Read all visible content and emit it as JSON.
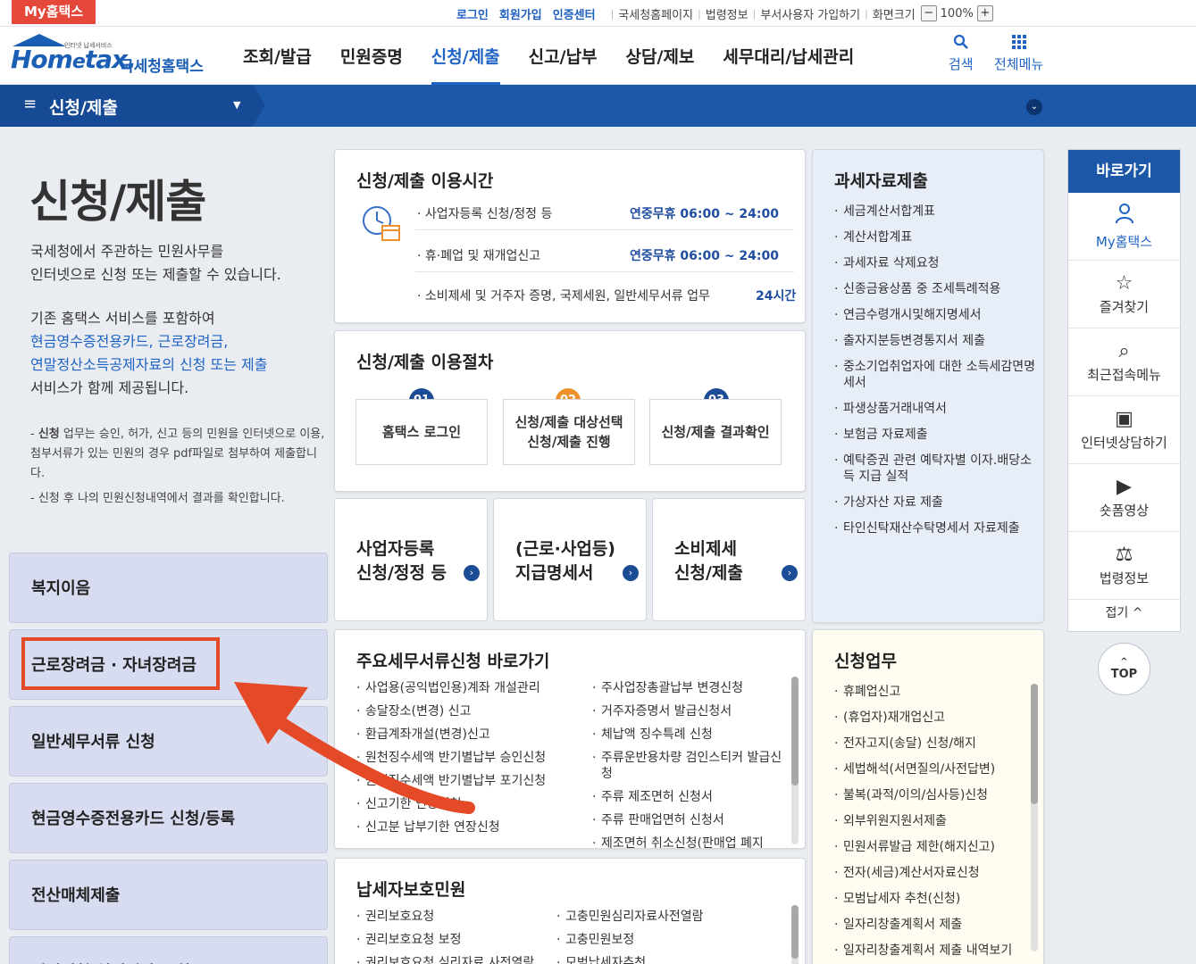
{
  "topbar": {
    "my_badge": "My홈택스",
    "login": "로그인",
    "join": "회원가입",
    "cert": "인증센터",
    "links": [
      "국세청홈페이지",
      "법령정보",
      "부서사용자 가입하기",
      "화면크기"
    ],
    "zoom_minus": "−",
    "zoom_value": "100%",
    "zoom_plus": "+"
  },
  "header": {
    "logo_small": "인터넷 납세서비스",
    "logo_home": "Hom",
    "logo_e": "e",
    "logo_tax": "tax.",
    "logo_kr": "국세청홈택스",
    "menu": [
      "조회/발급",
      "민원증명",
      "신청/제출",
      "신고/납부",
      "상담/제보",
      "세무대리/납세관리"
    ],
    "search": "검색",
    "all_menu": "전체메뉴"
  },
  "subnav": {
    "title": "신청/제출",
    "hamburger": "≡",
    "caret": "▼",
    "circle": "⌄"
  },
  "left": {
    "page_title": "신청/제출",
    "desc_line1": "국세청에서 주관하는 민원사무를",
    "desc_line2": "인터넷으로 신청 또는 제출할 수 있습니다.",
    "desc2_line1": "기존 홈택스 서비스를 포함하여",
    "desc2_blue1": "현금영수증전용카드, 근로장려금,",
    "desc2_blue2": "연말정산소득공제자료의 신청 또는 제출",
    "desc2_line4": "서비스가 함께 제공됩니다.",
    "note1_bold": "신청",
    "note1": " 업무는 승인, 허가, 신고 등의 민원을 인터넷으로 이용, 첨부서류가 있는 민원의 경우 pdf파일로 첨부하여 제출합니다.",
    "note2": "신청 후 나의 민원신청내역에서 결과를 확인합니다.",
    "buttons": [
      "복지이음",
      "근로장려금 · 자녀장려금",
      "일반세무서류 신청",
      "현금영수증전용카드 신청/등록",
      "전산매체제출",
      "민원신청 처리결과 조회"
    ]
  },
  "hours": {
    "title": "신청/제출 이용시간",
    "rows": [
      {
        "label": "사업자등록 신청/정정 등",
        "value": "연중무휴 06:00 ~ 24:00"
      },
      {
        "label": "휴·폐업 및 재개업신고",
        "value": "연중무휴 06:00 ~ 24:00"
      },
      {
        "label": "소비제세 및 거주자 증명, 국제세원, 일반세무서류 업무",
        "value": "24시간"
      }
    ]
  },
  "procedure": {
    "title": "신청/제출 이용절차",
    "steps": [
      {
        "num": "01",
        "line1": "홈택스 로그인",
        "line2": ""
      },
      {
        "num": "02",
        "line1": "신청/제출 대상선택",
        "line2": "신청/제출 진행"
      },
      {
        "num": "03",
        "line1": "신청/제출 결과확인",
        "line2": ""
      }
    ]
  },
  "tiles": [
    {
      "line1": "사업자등록",
      "line2": "신청/정정 등"
    },
    {
      "line1": "(근로·사업등)",
      "line2": "지급명세서"
    },
    {
      "line1": "소비제세",
      "line2": "신청/제출"
    }
  ],
  "tax_data": {
    "title": "과세자료제출",
    "items": [
      "세금계산서합계표",
      "계산서합계표",
      "과세자료 삭제요청",
      "신종금융상품 중 조세특례적용",
      "연금수령개시및해지명세서",
      "출자지분등변경통지서 제출",
      "중소기업취업자에 대한 소득세감면명세서",
      "파생상품거래내역서",
      "보험금 자료제출",
      "예탁증권 관련 예탁자별 이자.배당소득 지급 실적",
      "가상자산 자료 제출",
      "타인신탁재산수탁명세서 자료제출"
    ]
  },
  "main_docs": {
    "title": "주요세무서류신청 바로가기",
    "col1": [
      "사업용(공익법인용)계좌 개설관리",
      "송달장소(변경) 신고",
      "환급계좌개설(변경)신고",
      "원천징수세액 반기별납부 승인신청",
      "원천징수세액 반기별납부 포기신청",
      "신고기한 연장신청",
      "신고분 납부기한 연장신청"
    ],
    "col2": [
      "주사업장총괄납부 변경신청",
      "거주자증명서 발급신청서",
      "체납액 징수특례 신청",
      "주류운반용차량 검인스티커 발급신청",
      "주류 제조면허 신청서",
      "주류 판매업면허 신청서",
      "제조면허 취소신청(판매업 폐지"
    ]
  },
  "protect": {
    "title": "납세자보호민원",
    "col1": [
      "권리보호요청",
      "권리보호요청 보정",
      "권리보호요청 심리자료 사전열람"
    ],
    "col2": [
      "고충민원심리자료사전열람",
      "고충민원보정",
      "모범납세자추천"
    ]
  },
  "apply": {
    "title": "신청업무",
    "items": [
      "휴폐업신고",
      "(휴업자)재개업신고",
      "전자고지(송달) 신청/해지",
      "세법해석(서면질의/사전답변)",
      "불복(과적/이의/심사등)신청",
      "외부위원지원서제출",
      "민원서류발급 제한(해지신고)",
      "전자(세금)계산서자료신청",
      "모범납세자 추천(신청)",
      "일자리창출계획서 제출",
      "일자리창출계획서 제출 내역보기"
    ]
  },
  "quick": {
    "title": "바로가기",
    "items": [
      {
        "icon": "♙",
        "label": "My홈택스"
      },
      {
        "icon": "☆",
        "label": "즐겨찾기"
      },
      {
        "icon": "⌕",
        "label": "최근접속메뉴"
      },
      {
        "icon": "▣",
        "label": "인터넷상담하기"
      },
      {
        "icon": "▶",
        "label": "숏폼영상"
      },
      {
        "icon": "⚖",
        "label": "법령정보"
      }
    ],
    "fold": "접기 ^",
    "top": "TOP"
  },
  "colors": {
    "primary": "#1d57a8",
    "accent": "#e44a27",
    "badge_orange": "#f0902a"
  }
}
